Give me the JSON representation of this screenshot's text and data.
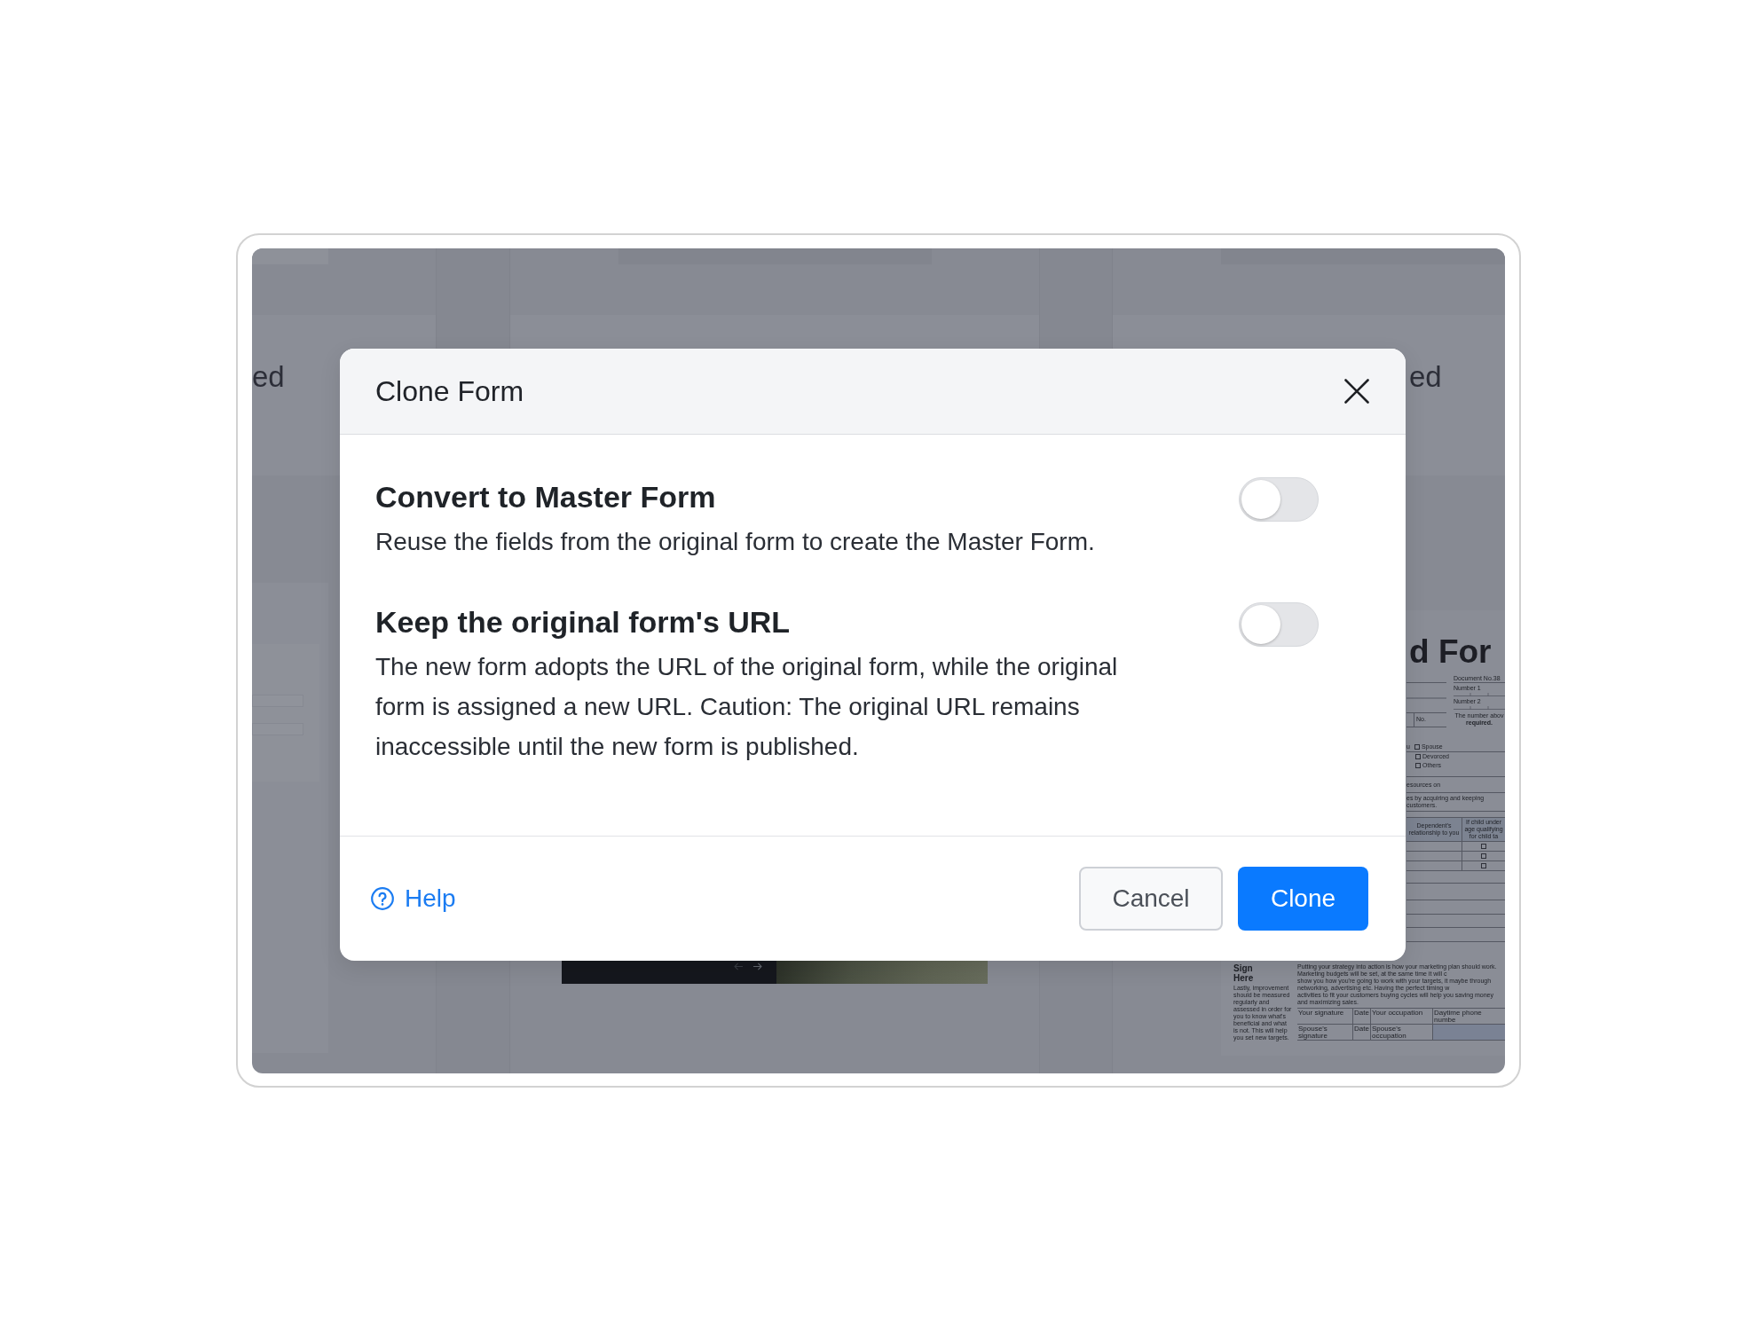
{
  "background": {
    "left_card": {
      "title": "ed"
    },
    "right_card": {
      "title": "ed"
    },
    "document_preview": {
      "title": "d For",
      "document_number": "Document No.38",
      "number_fields": [
        "Number 1",
        "Number 2"
      ],
      "number_note": [
        "The number abov",
        "required."
      ],
      "no_label": "No.",
      "status_prefix": "u",
      "status_options": [
        {
          "label": "Spouse",
          "checked": false
        },
        {
          "label": "Devorced",
          "checked": false
        },
        {
          "label": "Others",
          "checked": false
        }
      ],
      "text_lines": [
        "esources on",
        "es by acquiring and keeping customers."
      ],
      "dependents_columns": [
        "Dependent's relationship to you",
        "If child under age qualifying for child ta"
      ],
      "dependents_rows": [
        {
          "checked": false
        },
        {
          "checked": false
        },
        {
          "checked": false
        }
      ],
      "signature": {
        "heading": "Sign Here",
        "note": "Lastly, improvement should be measured regularly and assessed in order for you to know what's beneficial and what is not. This will help you set new targets.",
        "statement_lines": [
          "Putting your strategy into action is how your marketing plan should work. Marketing budgets will be set, at the same time it will c",
          "show you how you're going to work with your targets, it maybe through networking, advertising etc. Having the perfect timing w",
          "activities to fit your customers buying cycles will help you saving money and maximizing sales."
        ],
        "rows": [
          [
            "Your signature",
            "Date",
            "Your occupation",
            "Daytime phone numbe"
          ],
          [
            "Spouse's signature",
            "Date",
            "Spouse's occupation"
          ]
        ]
      }
    }
  },
  "dialog": {
    "title": "Clone Form",
    "options": [
      {
        "title": "Convert to Master Form",
        "description": "Reuse the fields from the original form to create the Master Form.",
        "on": false
      },
      {
        "title": "Keep the original form's URL",
        "description": "The new form adopts the URL of the original form, while the original form is assigned a new URL. Caution: The original URL remains inaccessible until the new form is published.",
        "on": false
      }
    ],
    "help": "Help",
    "buttons": [
      {
        "label": "Cancel",
        "kind": "secondary"
      },
      {
        "label": "Clone",
        "kind": "primary"
      }
    ]
  }
}
